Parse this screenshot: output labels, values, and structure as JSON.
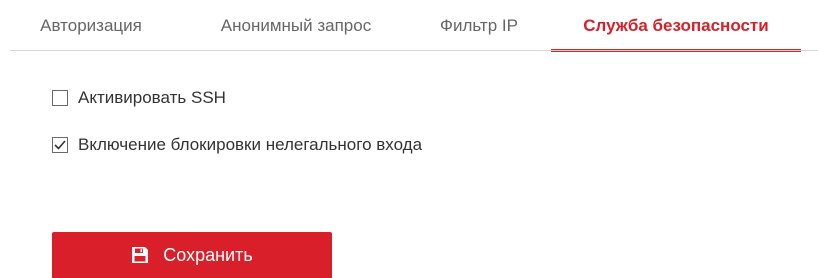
{
  "tabs": [
    {
      "label": "Авторизация",
      "active": false
    },
    {
      "label": "Анонимный запрос",
      "active": false
    },
    {
      "label": "Фильтр IP",
      "active": false
    },
    {
      "label": "Служба безопасности",
      "active": true
    }
  ],
  "options": [
    {
      "label": "Активировать SSH",
      "checked": false
    },
    {
      "label": "Включение блокировки нелегального входа",
      "checked": true
    }
  ],
  "save_button": {
    "label": "Сохранить",
    "icon": "floppy-disk-icon"
  },
  "colors": {
    "accent": "#d9202a",
    "tab_text": "#666666",
    "text": "#333333",
    "divider": "#d9d9d9"
  }
}
